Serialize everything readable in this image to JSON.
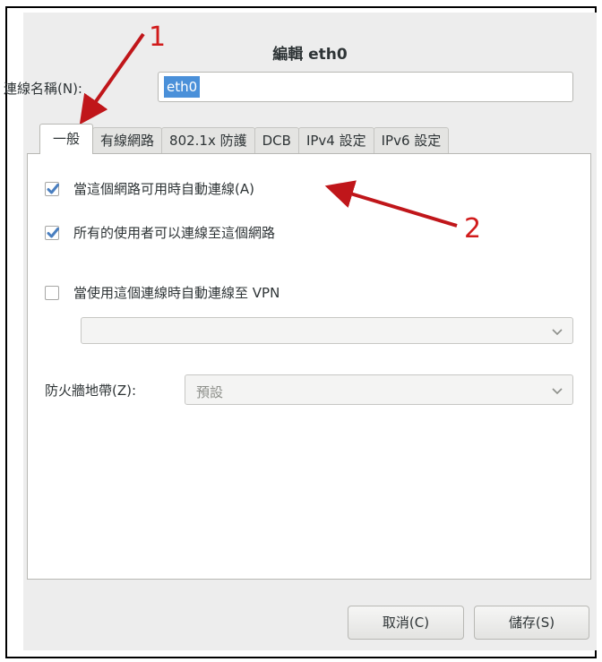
{
  "dialog": {
    "title": "編輯 eth0",
    "connection_name_label": "連線名稱(N):",
    "connection_name_value": "eth0"
  },
  "tabs": [
    {
      "label": "一般",
      "active": true
    },
    {
      "label": "有線網路",
      "active": false
    },
    {
      "label": "802.1x 防護",
      "active": false
    },
    {
      "label": "DCB",
      "active": false
    },
    {
      "label": "IPv4 設定",
      "active": false
    },
    {
      "label": "IPv6 設定",
      "active": false
    }
  ],
  "general": {
    "auto_connect_label": "當這個網路可用時自動連線(A)",
    "auto_connect_checked": true,
    "all_users_label": "所有的使用者可以連線至這個網路",
    "all_users_checked": true,
    "vpn_label": "當使用這個連線時自動連線至 VPN",
    "vpn_checked": false,
    "vpn_select_value": "",
    "firewall_label": "防火牆地帶(Z):",
    "firewall_value": "預設"
  },
  "buttons": {
    "cancel": "取消(C)",
    "save": "儲存(S)"
  },
  "annotations": {
    "marker_1": "1",
    "marker_2": "2",
    "color": "#d11b1b"
  },
  "colors": {
    "selection": "#4a90d9",
    "checkbox_check": "#4a7fc0"
  }
}
